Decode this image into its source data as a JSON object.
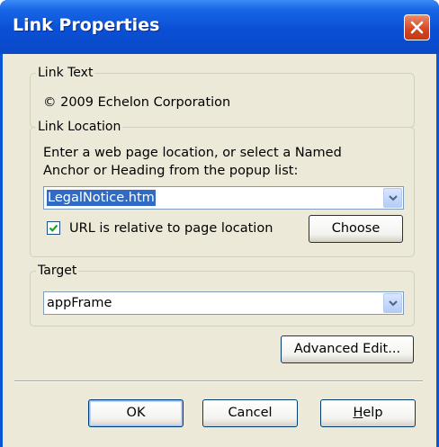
{
  "window": {
    "title": "Link Properties"
  },
  "link_text": {
    "legend": "Link Text",
    "value": "© 2009 Echelon Corporation"
  },
  "link_location": {
    "legend": "Link Location",
    "instruction_line1": "Enter a web page location, or select a Named",
    "instruction_line2": "Anchor or Heading from the popup list:",
    "url_value": "LegalNotice.htm",
    "relative_checkbox_label": "URL is relative to page location",
    "relative_checked": true,
    "choose_label": "Choose"
  },
  "target": {
    "legend": "Target",
    "value": "appFrame"
  },
  "buttons": {
    "advanced_edit": "Advanced Edit...",
    "ok": "OK",
    "cancel": "Cancel",
    "help_prefix": "",
    "help_accel": "H",
    "help_rest": "elp"
  },
  "colors": {
    "titlebar": "#0a4fd4",
    "face": "#ece9d8",
    "selection": "#316ac5",
    "close": "#d3461e"
  }
}
